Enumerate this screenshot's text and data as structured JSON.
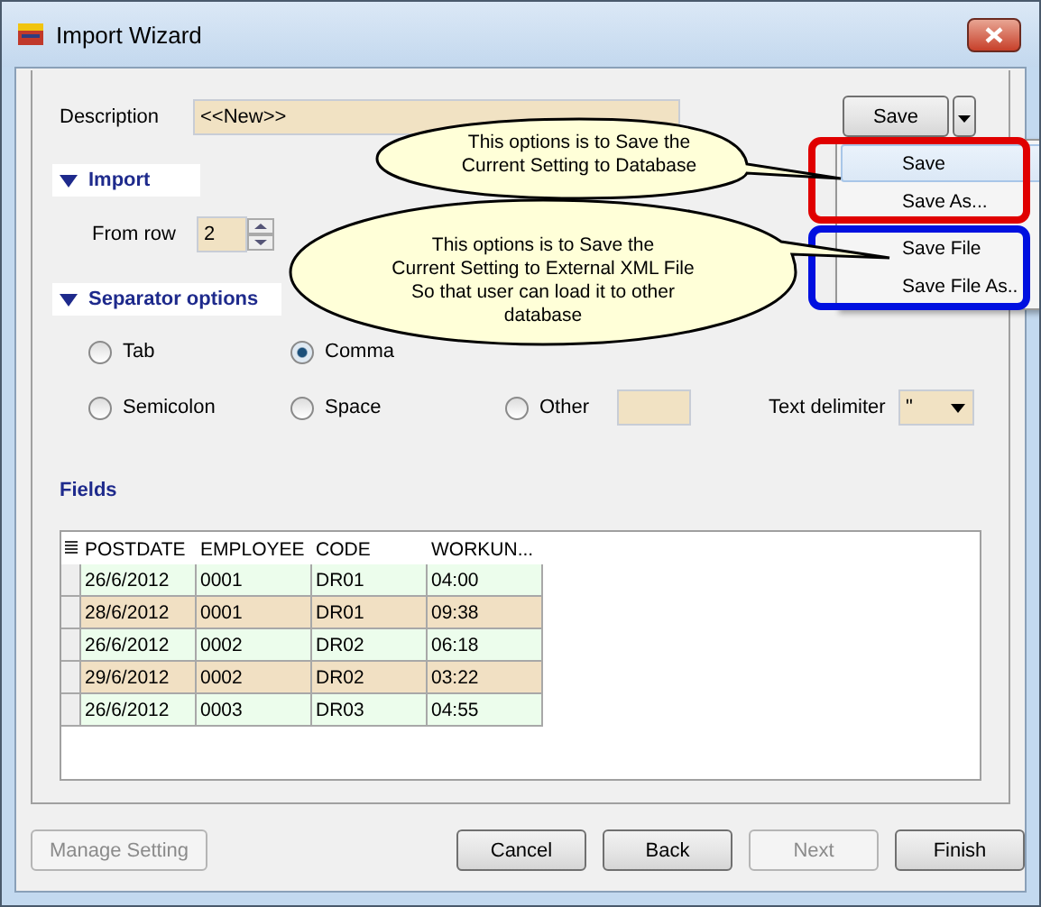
{
  "window": {
    "title": "Import Wizard"
  },
  "description": {
    "label": "Description",
    "value": "<<New>>"
  },
  "save_button": {
    "label": "Save"
  },
  "import": {
    "title": "Import",
    "expanded": true,
    "from_row": {
      "label": "From row",
      "value": "2"
    }
  },
  "separator": {
    "title": "Separator options",
    "expanded": true,
    "options": [
      {
        "label": "Tab",
        "selected": false
      },
      {
        "label": "Comma",
        "selected": true
      },
      {
        "label": "Semicolon",
        "selected": false
      },
      {
        "label": "Space",
        "selected": false
      },
      {
        "label": "Other",
        "selected": false
      }
    ],
    "text_delimiter": {
      "label": "Text delimiter",
      "value": "\""
    }
  },
  "fields": {
    "title": "Fields",
    "columns": [
      "POSTDATE",
      "EMPLOYEE",
      "CODE",
      "WORKUN..."
    ],
    "rows": [
      [
        "26/6/2012",
        "0001",
        "DR01",
        "04:00"
      ],
      [
        "28/6/2012",
        "0001",
        "DR01",
        "09:38"
      ],
      [
        "26/6/2012",
        "0002",
        "DR02",
        "06:18"
      ],
      [
        "29/6/2012",
        "0002",
        "DR02",
        "03:22"
      ],
      [
        "26/6/2012",
        "0003",
        "DR03",
        "04:55"
      ]
    ]
  },
  "buttons": [
    {
      "label": "Manage Setting",
      "disabled": true
    },
    {
      "label": "Cancel",
      "disabled": false
    },
    {
      "label": "Back",
      "disabled": false
    },
    {
      "label": "Next",
      "disabled": true
    },
    {
      "label": "Finish",
      "disabled": false
    }
  ],
  "save_menu": {
    "groups": [
      {
        "color": "#e00000",
        "callout": "This options is to Save the\nCurrent Setting to Database",
        "items": [
          {
            "label": "Save",
            "selected": true
          },
          {
            "label": "Save As...",
            "selected": false
          }
        ]
      },
      {
        "color": "#0010e0",
        "callout": "This options is to Save the\nCurrent Setting to External XML File\nSo that user can load it to other\ndatabase",
        "items": [
          {
            "label": "Save File",
            "selected": false
          },
          {
            "label": "Save File As..",
            "selected": false
          }
        ]
      }
    ]
  }
}
